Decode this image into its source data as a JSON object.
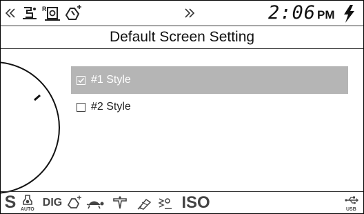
{
  "topbar": {
    "time": "2:06",
    "ampm": "PM",
    "icons": [
      "chevron-left-icon",
      "shooting-mode-icon",
      "raw-image-icon",
      "hand-mode-icon",
      "chevron-right-icon",
      "flash-icon"
    ]
  },
  "title": "Default Screen Setting",
  "options": [
    {
      "label": "#1 Style",
      "checked": true,
      "selected": true
    },
    {
      "label": "#2 Style",
      "checked": false,
      "selected": false
    }
  ],
  "bottombar": {
    "s_label": "S",
    "auto_label": "AUTO",
    "dig_label": "DIG",
    "iso_label": "ISO",
    "usb_label": "USB"
  },
  "colors": {
    "selection": "#b5b5b5",
    "text": "#222222",
    "border": "#000000"
  }
}
